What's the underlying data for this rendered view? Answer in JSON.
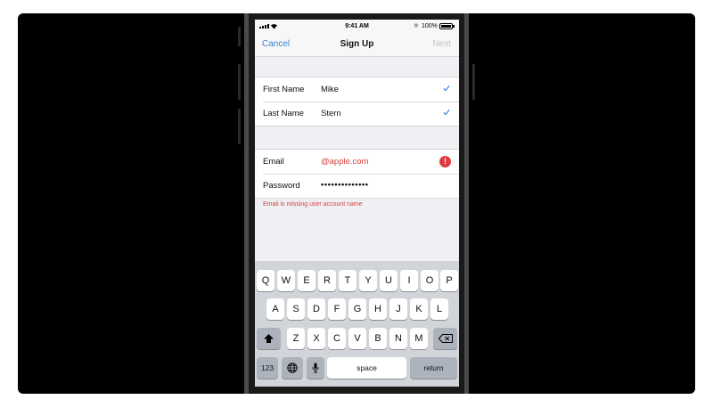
{
  "status_bar": {
    "time": "9:41 AM",
    "battery_percent": "100%",
    "bluetooth": "✱"
  },
  "nav": {
    "cancel": "Cancel",
    "title": "Sign Up",
    "next": "Next"
  },
  "name_group": [
    {
      "label": "First Name",
      "value": "Mike",
      "status": "valid"
    },
    {
      "label": "Last Name",
      "value": "Stern",
      "status": "valid"
    }
  ],
  "account_group": [
    {
      "label": "Email",
      "value": "@apple.com",
      "status": "error"
    },
    {
      "label": "Password",
      "value": "••••••••••••••",
      "status": "none"
    }
  ],
  "error_message": "Email is missing user account name",
  "keyboard": {
    "row1": [
      "Q",
      "W",
      "E",
      "R",
      "T",
      "Y",
      "U",
      "I",
      "O",
      "P"
    ],
    "row2": [
      "A",
      "S",
      "D",
      "F",
      "G",
      "H",
      "J",
      "K",
      "L"
    ],
    "row3": [
      "Z",
      "X",
      "C",
      "V",
      "B",
      "N",
      "M"
    ],
    "numbers": "123",
    "space": "space",
    "return": "return",
    "icons": {
      "shift": "shift-icon",
      "delete": "delete-icon",
      "globe": "globe-icon",
      "mic": "mic-icon"
    }
  },
  "colors": {
    "accent": "#3a86d8",
    "error": "#e0393e",
    "disabled": "#c3c3c8"
  }
}
